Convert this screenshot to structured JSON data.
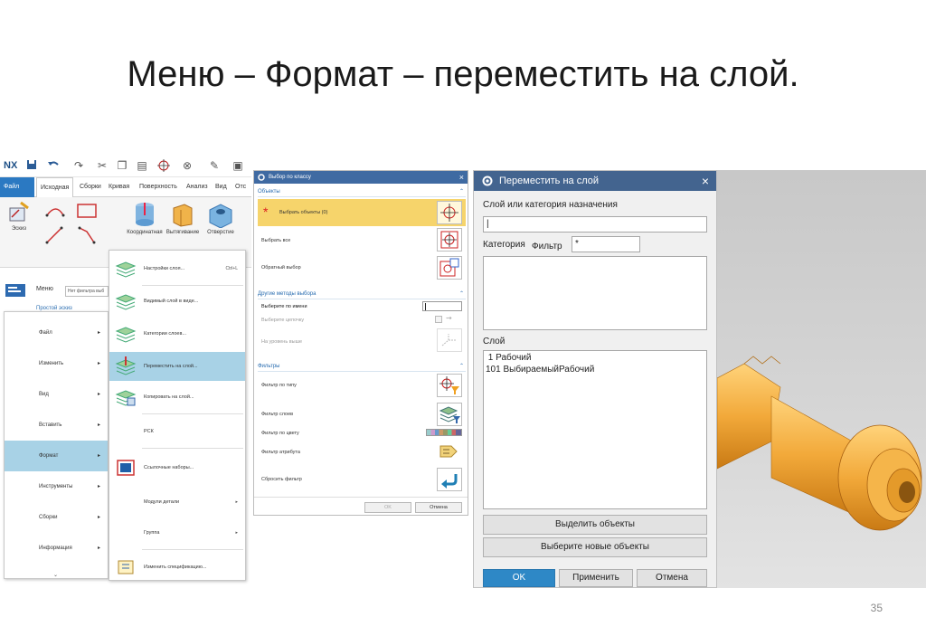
{
  "slide": {
    "title": "Меню – Формат – переместить на слой.",
    "page_number": "35"
  },
  "nx": {
    "logo": "NX",
    "tabs": [
      "Файл",
      "Исходная",
      "Сборки",
      "Кривая",
      "Поверхность",
      "Анализ",
      "Вид",
      "Отс"
    ],
    "ribbon": {
      "sketch": "Эскиз",
      "group_label": "Простой эскиз",
      "coord": "Координатная",
      "extrude": "Вытягивание",
      "hole": "Отверстие"
    },
    "menu_button": "Меню",
    "filter_placeholder": "Нет фильтра выб",
    "main_menu": [
      {
        "label": "Файл",
        "selected": false
      },
      {
        "label": "Изменить",
        "selected": false
      },
      {
        "label": "Вид",
        "selected": false
      },
      {
        "label": "Вставить",
        "selected": false
      },
      {
        "label": "Формат",
        "selected": true
      },
      {
        "label": "Инструменты",
        "selected": false
      },
      {
        "label": "Сборки",
        "selected": false
      },
      {
        "label": "Информация",
        "selected": false
      }
    ],
    "sub_menu": [
      {
        "label": "Настройки слоя...",
        "shortcut": "Ctrl+L",
        "selected": false
      },
      {
        "label": "Видимый слой в виде...",
        "shortcut": "",
        "selected": false
      },
      {
        "label": "Категории слоев...",
        "shortcut": "",
        "selected": false
      },
      {
        "label": "Переместить на слой...",
        "shortcut": "",
        "selected": true
      },
      {
        "label": "Копировать на слой...",
        "shortcut": "",
        "selected": false
      },
      {
        "label": "РСК",
        "shortcut": "",
        "selected": false
      },
      {
        "label": "Ссылочные наборы...",
        "shortcut": "",
        "selected": false
      },
      {
        "label": "Модули детали",
        "shortcut": "",
        "selected": false
      },
      {
        "label": "Группа",
        "shortcut": "",
        "selected": false
      },
      {
        "label": "Изменить спецификацию...",
        "shortcut": "",
        "selected": false
      }
    ]
  },
  "select_dialog": {
    "title": "Выбор по классу",
    "objects_section": "Объекты",
    "select_objects": "Выбрать объекты (0)",
    "select_all": "Выбрать все",
    "invert": "Обратный выбор",
    "other_section": "Другие методы выбора",
    "by_name": "Выберите по имени",
    "chain": "Выберите цепочку",
    "level_up": "На уровень выше",
    "filters_section": "Фильтры",
    "type_filter": "Фильтр по типу",
    "layer_filter": "Фильтр слоев",
    "color_filter": "Фильтр по цвету",
    "attr_filter": "Фильтр атрибута",
    "reset_filter": "Сбросить фильтр",
    "ok": "OK",
    "cancel": "Отмена"
  },
  "move_dialog": {
    "title": "Переместить на слой",
    "dest_label": "Слой или категория назначения",
    "dest_value": "|",
    "category_label": "Категория",
    "filter_label": "Фильтр",
    "filter_value": "*",
    "layer_label": "Слой",
    "layers": [
      " 1 Рабочий",
      "101 ВыбираемыйРабочий"
    ],
    "select_objects": "Выделить объекты",
    "select_new": "Выберите новые объекты",
    "ok": "OK",
    "apply": "Применить",
    "cancel": "Отмена"
  },
  "colors": {
    "accent": "#43648f",
    "ok_button": "#2e88c6",
    "selection": "#a8d2e6",
    "highlight_row": "#f6d46b",
    "model": "#f2a93a"
  }
}
